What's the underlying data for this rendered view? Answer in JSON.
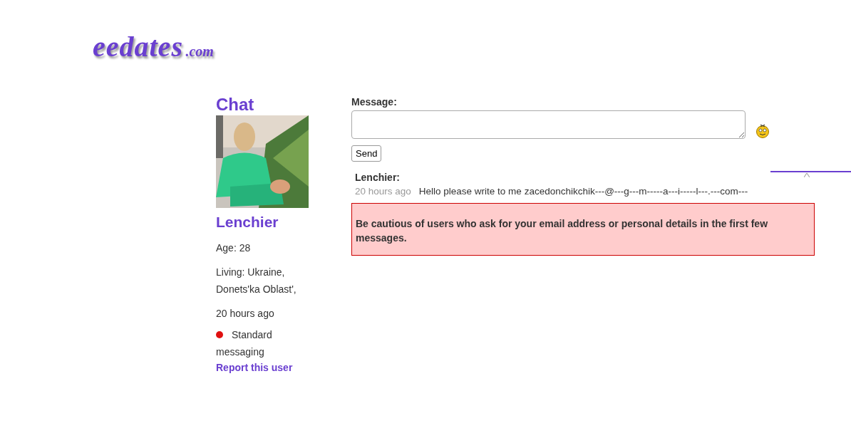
{
  "logo": {
    "name": "eedates",
    "suffix": ".com"
  },
  "profile": {
    "heading": "Chat",
    "name": "Lenchier",
    "age": "Age: 28",
    "living": "Living: Ukraine, Donets'ka Oblast',",
    "last_seen": "20 hours ago",
    "status": {
      "color": "#e01010",
      "label": "Standard messaging"
    },
    "report_link": "Report this user"
  },
  "composer": {
    "label": "Message:",
    "send_button": "Send"
  },
  "messages": [
    {
      "sender": "Lenchier:",
      "time": "20 hours ago",
      "text": "Hello please write to me zacedonchikchik---@---g---m-----a---i-----l---.---com---"
    }
  ],
  "warning": "Be cautious of users who ask for your email address or personal details in the first few messages."
}
